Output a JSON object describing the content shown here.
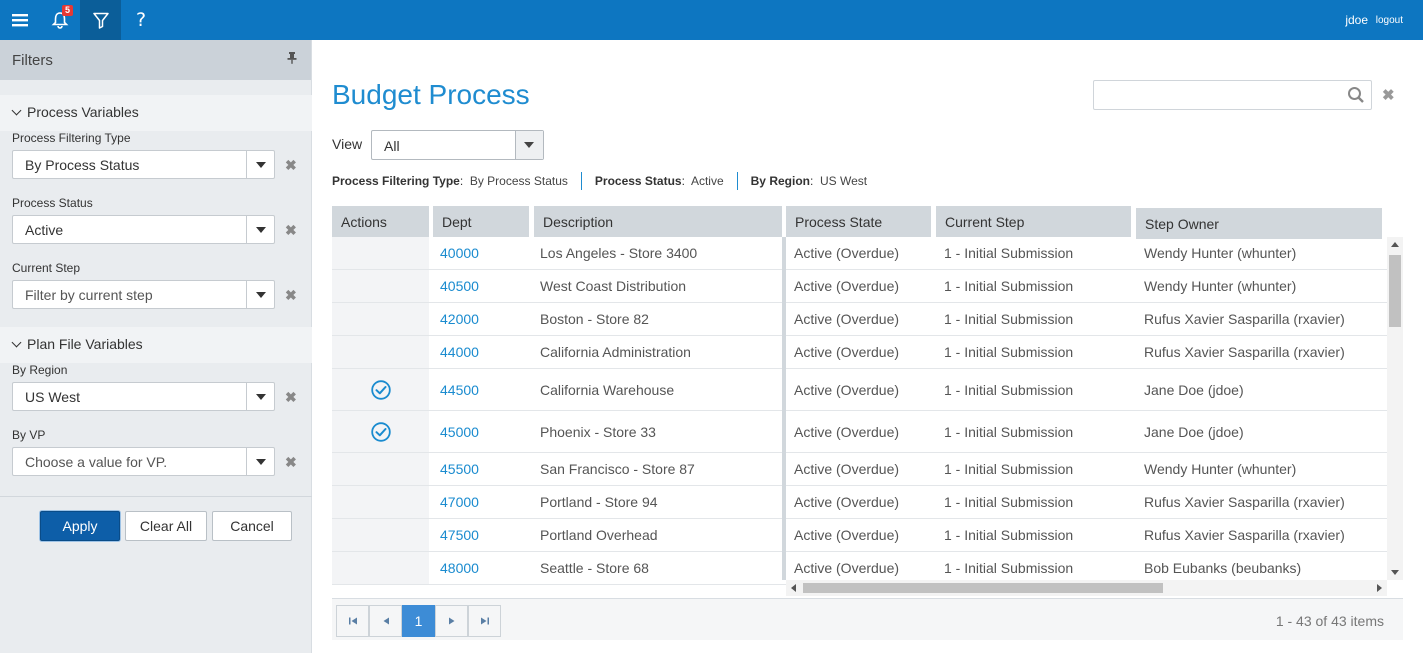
{
  "topbar": {
    "badge_count": "5",
    "help_label": "?",
    "user": "jdoe",
    "logout": "logout"
  },
  "sidebar": {
    "title": "Filters",
    "process_section": "Process Variables",
    "plan_section": "Plan File Variables",
    "filters": [
      {
        "label": "Process Filtering Type",
        "value": "By Process Status",
        "placeholder": false
      },
      {
        "label": "Process Status",
        "value": "Active",
        "placeholder": false
      },
      {
        "label": "Current Step",
        "value": "Filter by current step",
        "placeholder": true
      },
      {
        "label": "By Region",
        "value": "US West",
        "placeholder": false
      },
      {
        "label": "By VP",
        "value": "Choose a value for VP.",
        "placeholder": true
      }
    ],
    "buttons": {
      "apply": "Apply",
      "clear": "Clear All",
      "cancel": "Cancel"
    }
  },
  "main": {
    "title": "Budget Process",
    "search_value": "",
    "view_label": "View",
    "view_value": "All",
    "crumbs": [
      {
        "label": "Process Filtering Type",
        "value": "By Process Status"
      },
      {
        "label": "Process Status",
        "value": "Active"
      },
      {
        "label": "By Region",
        "value": "US West"
      }
    ]
  },
  "grid": {
    "columns": [
      "Actions",
      "Dept",
      "Description",
      "Process State",
      "Current Step",
      "Step Owner"
    ],
    "rows": [
      {
        "action": false,
        "dept": "40000",
        "desc": "Los Angeles - Store 3400",
        "state": "Active (Overdue)",
        "step": "1 - Initial Submission",
        "owner": "Wendy Hunter (whunter)"
      },
      {
        "action": false,
        "dept": "40500",
        "desc": "West Coast Distribution",
        "state": "Active (Overdue)",
        "step": "1 - Initial Submission",
        "owner": "Wendy Hunter (whunter)"
      },
      {
        "action": false,
        "dept": "42000",
        "desc": "Boston - Store 82",
        "state": "Active (Overdue)",
        "step": "1 - Initial Submission",
        "owner": "Rufus Xavier Sasparilla (rxavier)"
      },
      {
        "action": false,
        "dept": "44000",
        "desc": "California Administration",
        "state": "Active (Overdue)",
        "step": "1 - Initial Submission",
        "owner": "Rufus Xavier Sasparilla (rxavier)"
      },
      {
        "action": true,
        "dept": "44500",
        "desc": "California Warehouse",
        "state": "Active (Overdue)",
        "step": "1 - Initial Submission",
        "owner": "Jane Doe (jdoe)"
      },
      {
        "action": true,
        "dept": "45000",
        "desc": "Phoenix - Store 33",
        "state": "Active (Overdue)",
        "step": "1 - Initial Submission",
        "owner": "Jane Doe (jdoe)"
      },
      {
        "action": false,
        "dept": "45500",
        "desc": "San Francisco - Store 87",
        "state": "Active (Overdue)",
        "step": "1 - Initial Submission",
        "owner": "Wendy Hunter (whunter)"
      },
      {
        "action": false,
        "dept": "47000",
        "desc": "Portland - Store 94",
        "state": "Active (Overdue)",
        "step": "1 - Initial Submission",
        "owner": "Rufus Xavier Sasparilla (rxavier)"
      },
      {
        "action": false,
        "dept": "47500",
        "desc": "Portland Overhead",
        "state": "Active (Overdue)",
        "step": "1 - Initial Submission",
        "owner": "Rufus Xavier Sasparilla (rxavier)"
      },
      {
        "action": false,
        "dept": "48000",
        "desc": "Seattle - Store 68",
        "state": "Active (Overdue)",
        "step": "1 - Initial Submission",
        "owner": "Bob Eubanks (beubanks)"
      }
    ]
  },
  "pager": {
    "current_page": "1",
    "info": "1 - 43 of 43 items"
  },
  "colors": {
    "topbar": "#0d76c1",
    "accent": "#1f8cd0",
    "apply_button": "#0d5ea8"
  },
  "icons": [
    "menu-icon",
    "bell-icon",
    "filter-icon",
    "help-icon",
    "pin-icon",
    "search-icon",
    "close-icon",
    "chevron-down-icon",
    "check-circle-icon",
    "first-page-icon",
    "prev-page-icon",
    "next-page-icon",
    "last-page-icon"
  ]
}
